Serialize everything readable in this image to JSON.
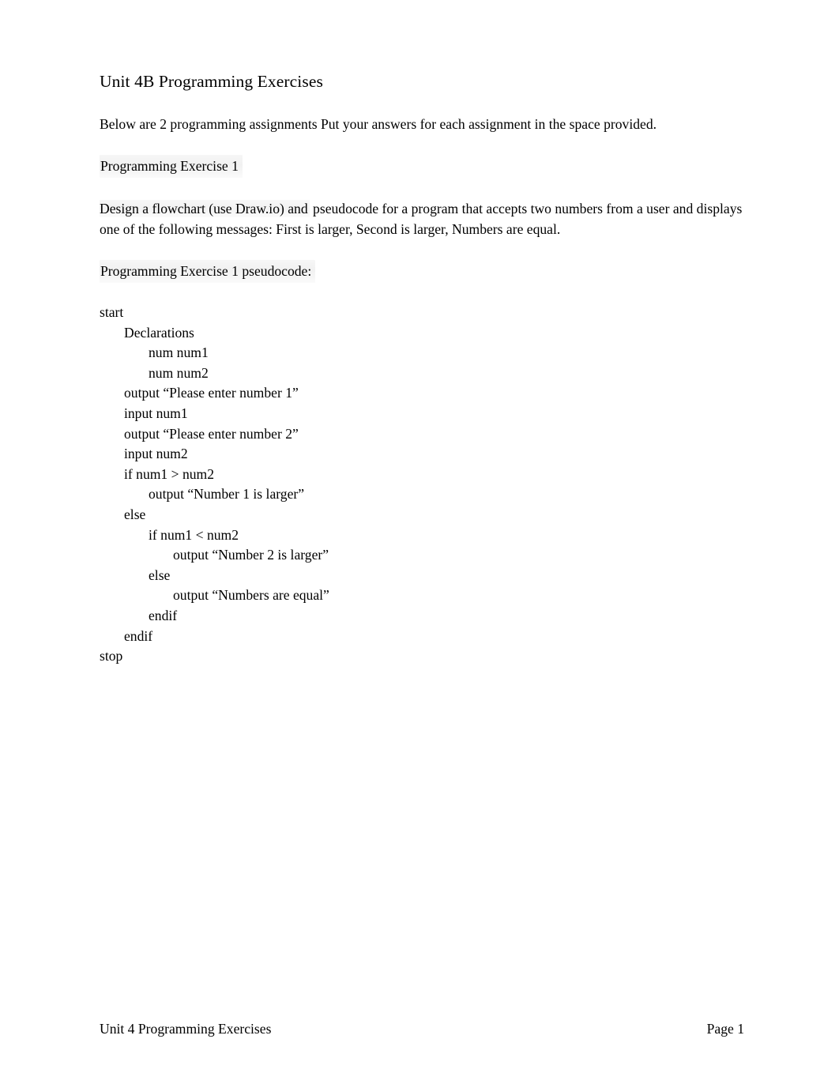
{
  "document": {
    "title": "Unit 4B Programming Exercises",
    "intro": "Below are 2 programming assignments Put your answers for each assignment in the space provided.",
    "exercise1_heading": "Programming Exercise 1",
    "exercise1_prompt_part1": "Design a flowchart (use Draw.io) and",
    "exercise1_prompt_part2": " pseudocode for a program that accepts two numbers from a user and displays one of the following messages: First is larger, Second is larger, Numbers are equal.",
    "pseudocode_heading": "Programming Exercise 1 pseudocode:"
  },
  "pseudocode": {
    "lines": [
      {
        "indent": 0,
        "text": "start"
      },
      {
        "indent": 1,
        "text": "Declarations"
      },
      {
        "indent": 2,
        "text": "num num1"
      },
      {
        "indent": 2,
        "text": "num num2"
      },
      {
        "indent": 1,
        "text": "output “Please enter number 1”"
      },
      {
        "indent": 1,
        "text": "input num1"
      },
      {
        "indent": 1,
        "text": "output “Please enter number 2”"
      },
      {
        "indent": 1,
        "text": "input num2"
      },
      {
        "indent": 1,
        "text": "if num1 > num2"
      },
      {
        "indent": 2,
        "text": "output “Number 1 is larger”"
      },
      {
        "indent": 1,
        "text": "else"
      },
      {
        "indent": 2,
        "text": "if num1 < num2"
      },
      {
        "indent": 3,
        "text": "output “Number 2 is larger”"
      },
      {
        "indent": 2,
        "text": "else"
      },
      {
        "indent": 3,
        "text": "output “Numbers are equal”"
      },
      {
        "indent": 2,
        "text": "endif"
      },
      {
        "indent": 1,
        "text": "endif"
      },
      {
        "indent": 0,
        "text": "stop"
      }
    ]
  },
  "footer": {
    "left": "Unit 4 Programming Exercises",
    "right": "Page 1"
  },
  "colors": {
    "page_background": "#ffffff",
    "text": "#000000",
    "highlight_shade": "#f0f0f0"
  }
}
